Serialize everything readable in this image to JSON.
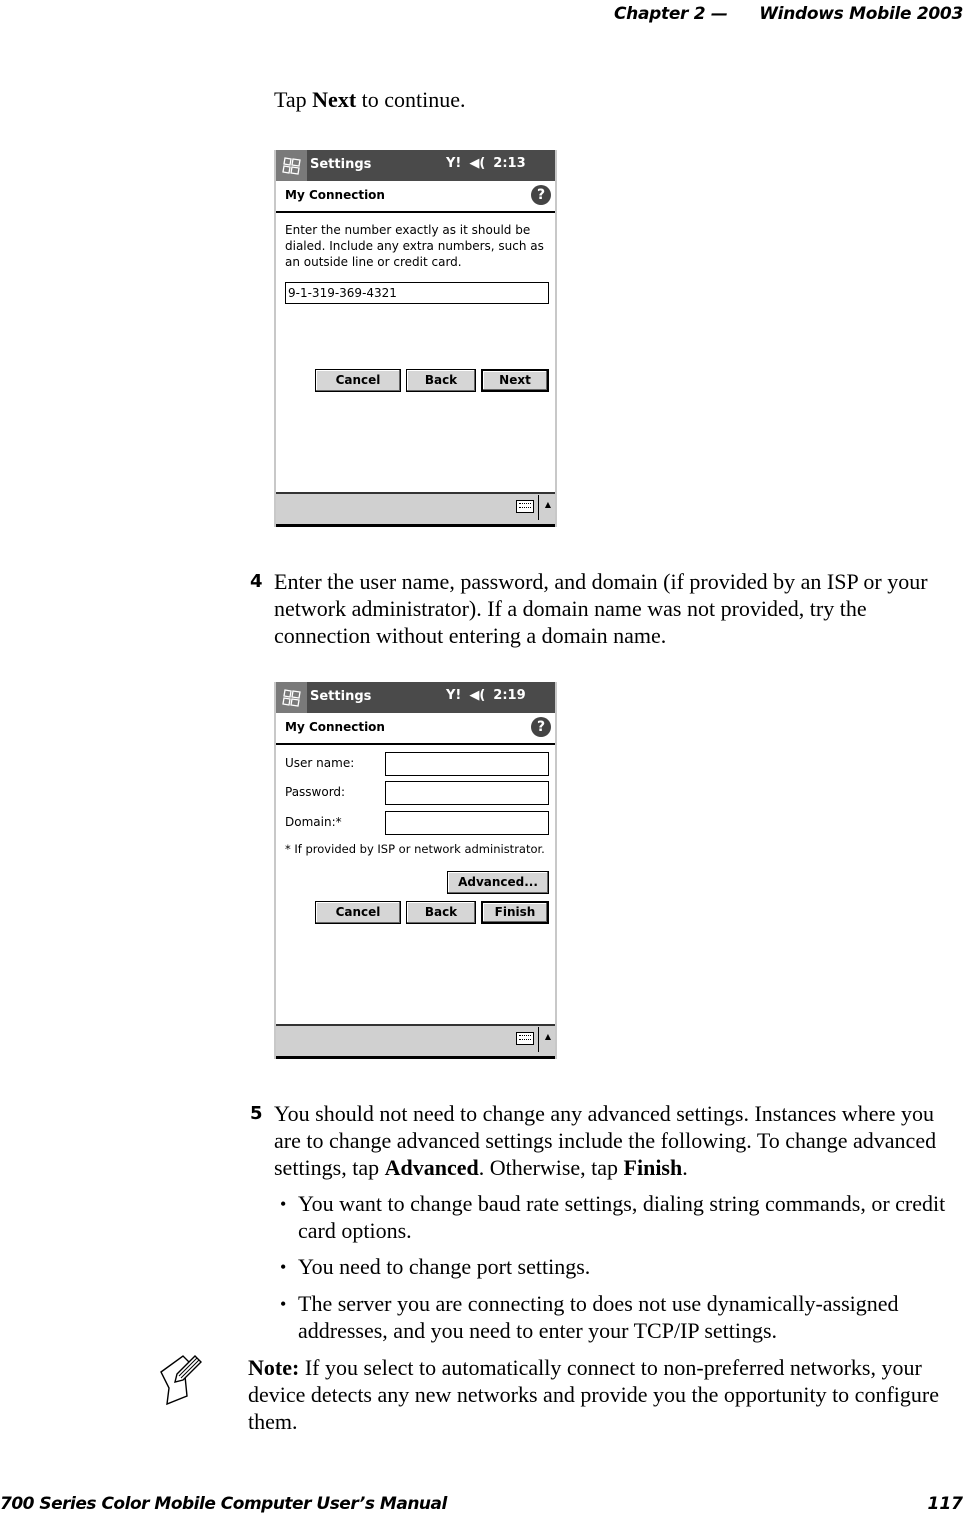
{
  "header": {
    "chapter": "Chapter  2  —",
    "section": "Windows Mobile 2003"
  },
  "intro": {
    "prefix": "Tap ",
    "keyword": "Next",
    "suffix": " to continue."
  },
  "screen1": {
    "app_title": "Settings",
    "status_icons": [
      "signal-icon",
      "speaker-icon"
    ],
    "time": "2:13",
    "page_title": "My Connection",
    "help_glyph": "?",
    "instructions": "Enter the number exactly as it should be dialed.  Include any extra numbers, such as an outside line or credit card.",
    "phone_value": "9-1-319-369-4321",
    "buttons": {
      "cancel": "Cancel",
      "back": "Back",
      "next": "Next"
    }
  },
  "step4": {
    "number": "4",
    "text": "Enter the user name, password, and domain (if provided by an ISP or your network administrator). If a domain name was not provided, try the connection without entering a domain name."
  },
  "screen2": {
    "app_title": "Settings",
    "time": "2:19",
    "page_title": "My Connection",
    "help_glyph": "?",
    "labels": {
      "user": "User name:",
      "password": "Password:",
      "domain": "Domain:*"
    },
    "values": {
      "user": "",
      "password": "",
      "domain": ""
    },
    "footnote": "* If provided by ISP or network administrator.",
    "buttons": {
      "advanced": "Advanced...",
      "cancel": "Cancel",
      "back": "Back",
      "finish": "Finish"
    }
  },
  "step5": {
    "number": "5",
    "text_pre": "You should not need to change any advanced settings. Instances where you are to change advanced settings include the following. To change advanced settings, tap ",
    "kw1": "Advanced",
    "text_mid": ". Otherwise, tap ",
    "kw2": "Finish",
    "text_post": ".",
    "bullets": [
      "You want to change baud rate settings, dialing string commands, or credit card options.",
      "You need to change port settings.",
      "The server you are connecting to does not use dynamically-assigned addresses, and you need to enter your TCP/IP settings."
    ]
  },
  "note": {
    "label": "Note:",
    "text": " If you select to automatically connect to non-preferred networks, your device detects any new networks and provide you the opportunity to configure them."
  },
  "footer": {
    "manual": "700 Series Color Mobile Computer User’s Manual",
    "page": "117"
  }
}
